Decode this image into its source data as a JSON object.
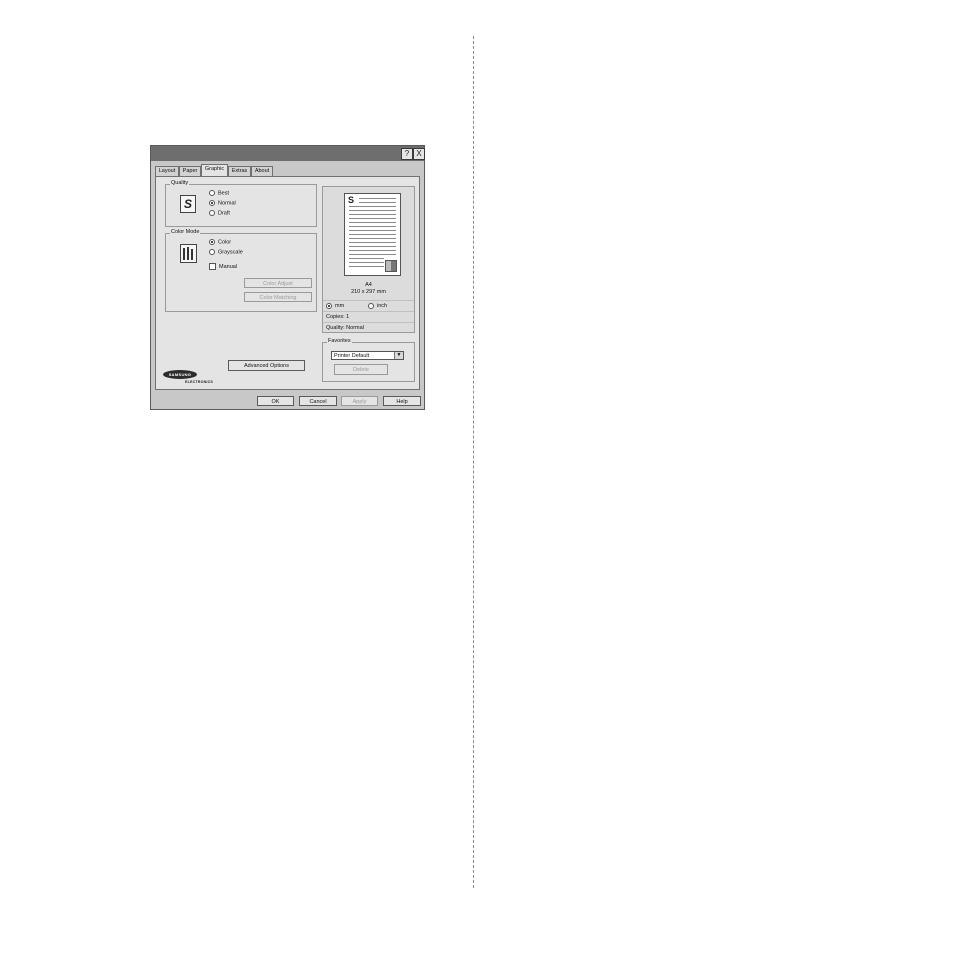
{
  "dialog": {
    "title_buttons": {
      "help": "?",
      "close": "X"
    },
    "tabs": [
      {
        "label": "Layout"
      },
      {
        "label": "Paper"
      },
      {
        "label": "Graphic"
      },
      {
        "label": "Extras"
      },
      {
        "label": "About"
      }
    ],
    "active_tab": "Graphic",
    "quality": {
      "label": "Quality",
      "options": [
        "Best",
        "Normal",
        "Draft"
      ],
      "selected": "Normal",
      "icon": "S"
    },
    "color_mode": {
      "label": "Color Mode",
      "options": [
        "Color",
        "Grayscale"
      ],
      "selected": "Color",
      "manual_label": "Manual",
      "manual_checked": false,
      "color_adjust_label": "Color Adjust",
      "color_matching_label": "Color Matching"
    },
    "advanced_options_label": "Advanced Options",
    "preview": {
      "sheet_letter": "S",
      "paper_name": "A4",
      "paper_size": "210 x 297 mm",
      "unit_options": [
        "mm",
        "inch"
      ],
      "unit_selected": "mm",
      "copies": "Copies: 1",
      "quality": "Quality: Normal"
    },
    "favorites": {
      "label": "Favorites",
      "selected": "Printer Default",
      "delete_label": "Delete"
    },
    "logo": {
      "brand": "SAMSUNG",
      "sub": "ELECTRONICS"
    },
    "buttons": {
      "ok": "OK",
      "cancel": "Cancel",
      "apply": "Apply",
      "help": "Help"
    }
  }
}
